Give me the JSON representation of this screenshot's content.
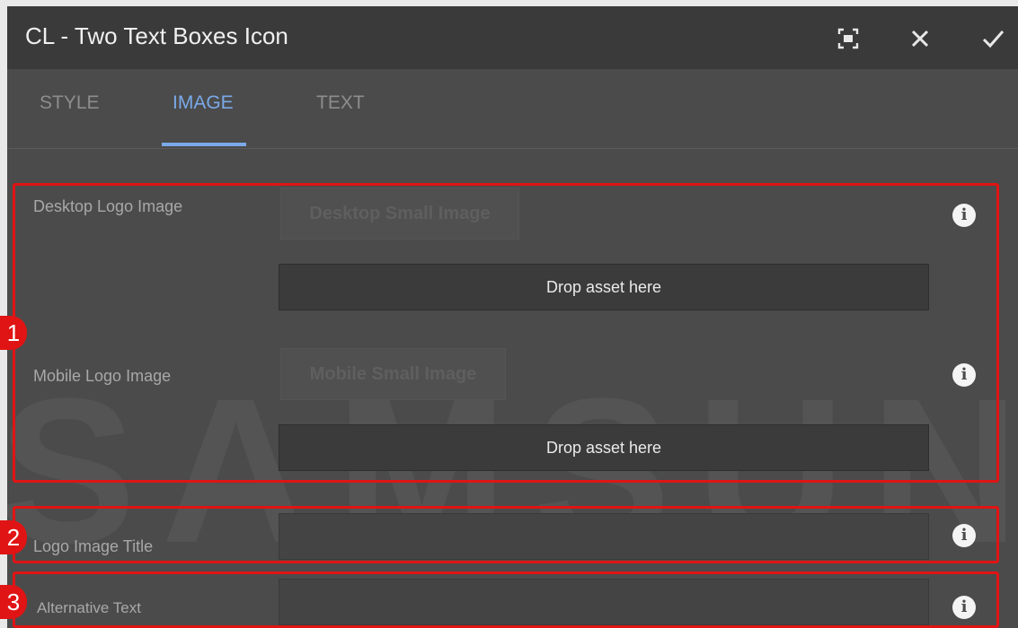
{
  "dialog": {
    "title": "CL - Two Text Boxes Icon",
    "icons": [
      "fullscreen-icon",
      "close-icon",
      "check-icon"
    ]
  },
  "tabs": [
    {
      "label": "STYLE",
      "active": false
    },
    {
      "label": "IMAGE",
      "active": true
    },
    {
      "label": "TEXT",
      "active": false
    }
  ],
  "watermark": "SAMSUNG",
  "fields": {
    "desktop_logo": {
      "label": "Desktop Logo Image",
      "button": "Desktop Small Image",
      "dropzone": "Drop asset here"
    },
    "mobile_logo": {
      "label": "Mobile Logo Image",
      "button": "Mobile Small Image",
      "dropzone": "Drop asset here"
    },
    "logo_title": {
      "label": "Logo Image Title",
      "value": ""
    },
    "alt_text": {
      "label": "Alternative Text",
      "value": ""
    }
  },
  "info_glyph": "i",
  "callouts": [
    "1",
    "2",
    "3"
  ],
  "colors": {
    "accent": "#7aa9e8",
    "highlight": "#e01414"
  }
}
